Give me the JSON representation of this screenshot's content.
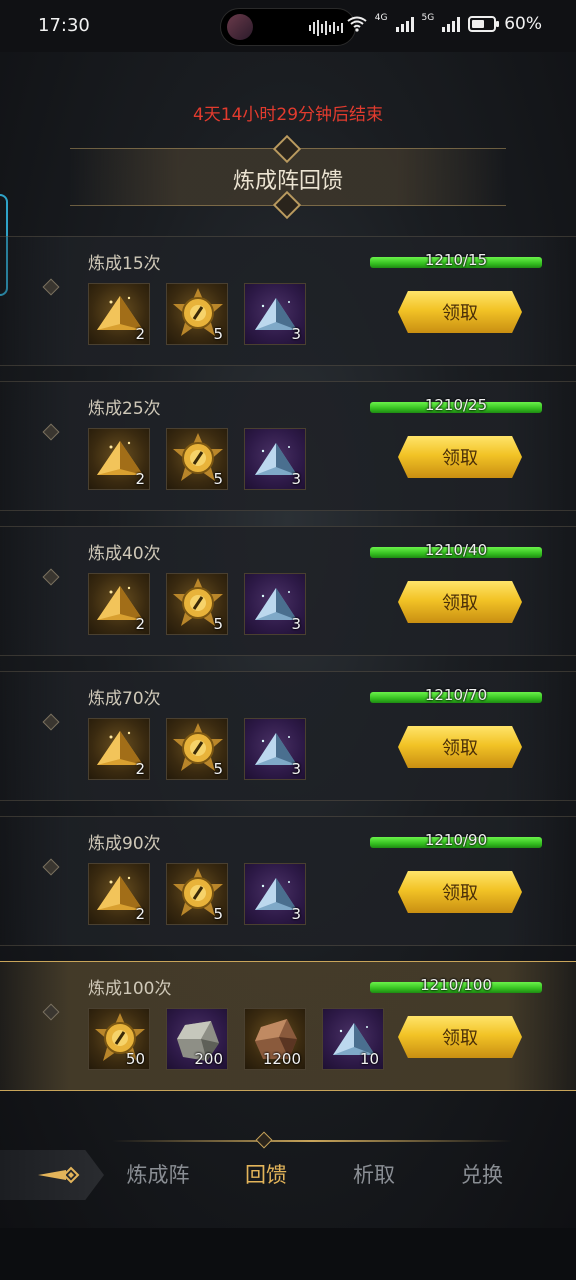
{
  "status_bar": {
    "time": "17:30",
    "network": "4G",
    "network2": "5G",
    "battery": "60%",
    "battery_level": 0.6
  },
  "event": {
    "timer": "4天14小时29分钟后结束",
    "title": "炼成阵回馈"
  },
  "rows": [
    {
      "label": "炼成15次",
      "progress": "1210/15",
      "fraction": 1,
      "claim": "领取",
      "items": [
        {
          "icon": "gold-pyramid-icon",
          "qty": "2",
          "tier": "gold"
        },
        {
          "icon": "gold-orb-icon",
          "qty": "5",
          "tier": "gold"
        },
        {
          "icon": "blue-crystal-icon",
          "qty": "3",
          "tier": "purple"
        }
      ]
    },
    {
      "label": "炼成25次",
      "progress": "1210/25",
      "fraction": 1,
      "claim": "领取",
      "items": [
        {
          "icon": "gold-pyramid-icon",
          "qty": "2",
          "tier": "gold"
        },
        {
          "icon": "gold-orb-icon",
          "qty": "5",
          "tier": "gold"
        },
        {
          "icon": "blue-crystal-icon",
          "qty": "3",
          "tier": "purple"
        }
      ]
    },
    {
      "label": "炼成40次",
      "progress": "1210/40",
      "fraction": 1,
      "claim": "领取",
      "items": [
        {
          "icon": "gold-pyramid-icon",
          "qty": "2",
          "tier": "gold"
        },
        {
          "icon": "gold-orb-icon",
          "qty": "5",
          "tier": "gold"
        },
        {
          "icon": "blue-crystal-icon",
          "qty": "3",
          "tier": "purple"
        }
      ]
    },
    {
      "label": "炼成70次",
      "progress": "1210/70",
      "fraction": 1,
      "claim": "领取",
      "items": [
        {
          "icon": "gold-pyramid-icon",
          "qty": "2",
          "tier": "gold"
        },
        {
          "icon": "gold-orb-icon",
          "qty": "5",
          "tier": "gold"
        },
        {
          "icon": "blue-crystal-icon",
          "qty": "3",
          "tier": "purple"
        }
      ]
    },
    {
      "label": "炼成90次",
      "progress": "1210/90",
      "fraction": 1,
      "claim": "领取",
      "items": [
        {
          "icon": "gold-pyramid-icon",
          "qty": "2",
          "tier": "gold"
        },
        {
          "icon": "gold-orb-icon",
          "qty": "5",
          "tier": "gold"
        },
        {
          "icon": "blue-crystal-icon",
          "qty": "3",
          "tier": "purple"
        }
      ]
    },
    {
      "label": "炼成100次",
      "progress": "1210/100",
      "fraction": 1,
      "claim": "领取",
      "highlight": true,
      "items": [
        {
          "icon": "gold-orb-icon",
          "qty": "50",
          "tier": "gold"
        },
        {
          "icon": "grey-ore-icon",
          "qty": "200",
          "tier": "purple"
        },
        {
          "icon": "copper-ore-icon",
          "qty": "1200",
          "tier": "gold"
        },
        {
          "icon": "blue-crystal-icon",
          "qty": "10",
          "tier": "purple"
        }
      ]
    }
  ],
  "nav": {
    "tabs": [
      "炼成阵",
      "回馈",
      "析取",
      "兑换"
    ],
    "active": 1
  },
  "colors": {
    "timer": "#e23b2e",
    "progress": "#35c020",
    "claim": "#f2c326",
    "active_tab": "#e3b45a"
  }
}
